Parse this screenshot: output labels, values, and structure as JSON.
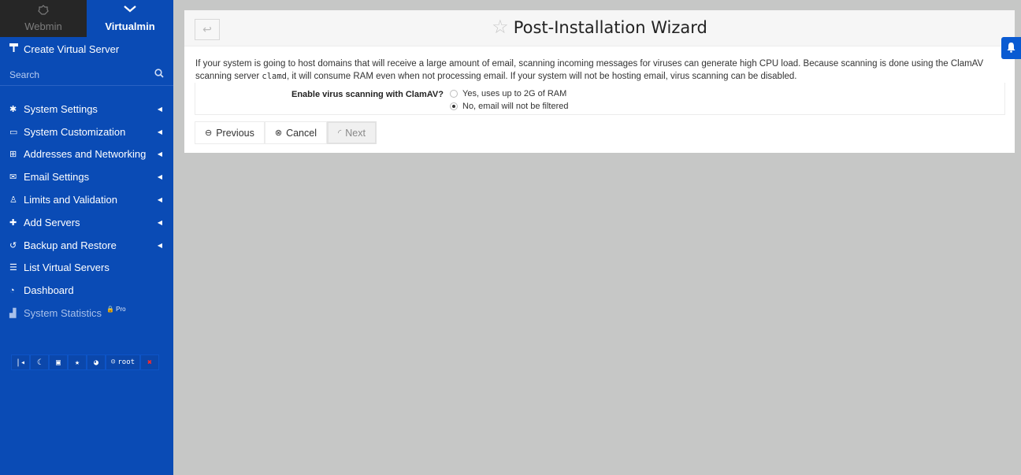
{
  "sidebar": {
    "tabs": [
      {
        "label": "Webmin",
        "icon": "webmin-icon"
      },
      {
        "label": "Virtualmin",
        "icon": "chevron-down-icon"
      }
    ],
    "create_virtual_server": "Create Virtual Server",
    "search_placeholder": "Search",
    "menu": [
      {
        "label": "System Settings",
        "icon": "gear-icon",
        "has_caret": true
      },
      {
        "label": "System Customization",
        "icon": "laptop-icon",
        "has_caret": true
      },
      {
        "label": "Addresses and Networking",
        "icon": "network-icon",
        "has_caret": true
      },
      {
        "label": "Email Settings",
        "icon": "envelope-icon",
        "has_caret": true
      },
      {
        "label": "Limits and Validation",
        "icon": "user-shield-icon",
        "has_caret": true
      },
      {
        "label": "Add Servers",
        "icon": "plus-icon",
        "has_caret": true
      },
      {
        "label": "Backup and Restore",
        "icon": "history-icon",
        "has_caret": true
      },
      {
        "label": "List Virtual Servers",
        "icon": "list-icon",
        "has_caret": false
      },
      {
        "label": "Dashboard",
        "icon": "dashboard-icon",
        "has_caret": false
      },
      {
        "label": "System Statistics",
        "icon": "chart-icon",
        "has_caret": false,
        "pro": "Pro"
      }
    ],
    "bottom_user": "root"
  },
  "panel": {
    "title": "Post-Installation Wizard",
    "description_part1": "If your system is going to host domains that will receive a large amount of email, scanning incoming messages for viruses can generate high CPU load. Because scanning is done using the ClamAV scanning server ",
    "description_code": "clamd",
    "description_part2": ", it will consume RAM even when not processing email. If your system will not be hosting email, virus scanning can be disabled.",
    "option_label": "Enable virus scanning with ClamAV?",
    "options": [
      {
        "label": "Yes, uses up to 2G of RAM",
        "checked": false
      },
      {
        "label": "No, email will not be filtered",
        "checked": true
      }
    ],
    "buttons": {
      "previous": "Previous",
      "cancel": "Cancel",
      "next": "Next"
    }
  },
  "colors": {
    "sidebar_bg": "#0a4bb5",
    "webmin_tab_bg": "#262626",
    "page_bg": "#c6c7c6"
  }
}
